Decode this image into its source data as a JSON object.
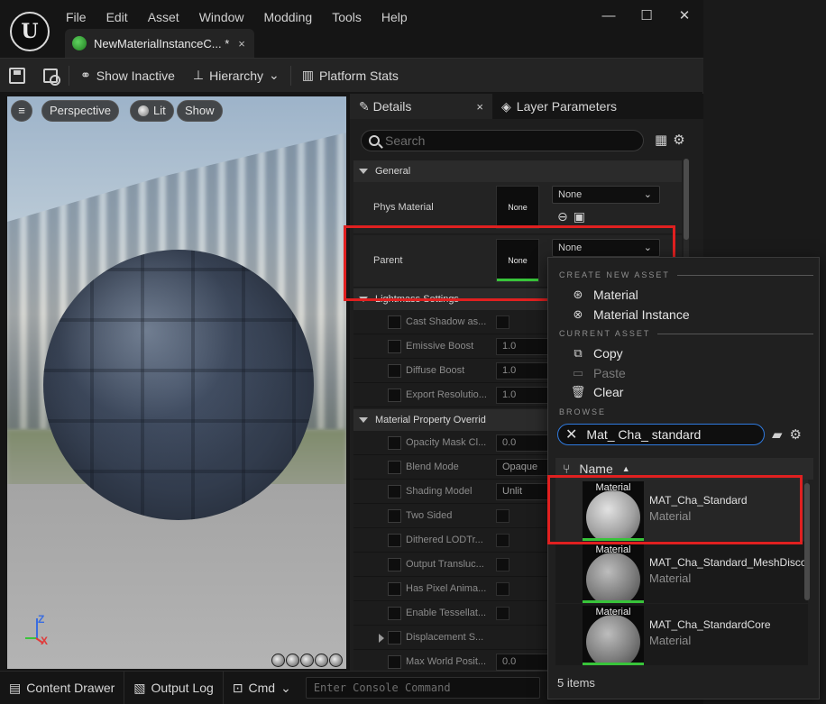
{
  "menu": {
    "items": [
      "File",
      "Edit",
      "Asset",
      "Window",
      "Modding",
      "Tools",
      "Help"
    ]
  },
  "window_controls": {
    "minimize": "—",
    "maximize": "☐",
    "close": "✕"
  },
  "doc_tab": {
    "label": "NewMaterialInstanceC... *",
    "close": "×"
  },
  "toolbar": {
    "show_inactive": "Show Inactive",
    "hierarchy": "Hierarchy",
    "platform_stats": "Platform Stats"
  },
  "viewport": {
    "perspective": "Perspective",
    "lit": "Lit",
    "show": "Show",
    "axis_z": "Z",
    "axis_x": "X"
  },
  "details": {
    "tab_details": "Details",
    "tab_layer_params": "Layer Parameters",
    "search_placeholder": "Search",
    "category_general": "General",
    "phys_material_label": "Phys Material",
    "phys_material_thumb": "None",
    "phys_material_value": "None",
    "parent_label": "Parent",
    "parent_thumb": "None",
    "parent_value": "None",
    "category_lightmass": "Lightmass Settings",
    "lightmass_rows": [
      {
        "label": "Cast Shadow as...",
        "kind": "check"
      },
      {
        "label": "Emissive Boost",
        "kind": "num",
        "value": "1.0"
      },
      {
        "label": "Diffuse Boost",
        "kind": "num",
        "value": "1.0"
      },
      {
        "label": "Export Resolutio...",
        "kind": "num",
        "value": "1.0"
      }
    ],
    "category_material_overrides": "Material Property Overrid",
    "override_rows": [
      {
        "label": "Opacity Mask Cl...",
        "kind": "num",
        "value": "0.0"
      },
      {
        "label": "Blend Mode",
        "kind": "opt",
        "value": "Opaque"
      },
      {
        "label": "Shading Model",
        "kind": "opt",
        "value": "Unlit"
      },
      {
        "label": "Two Sided",
        "kind": "check"
      },
      {
        "label": "Dithered LODTr...",
        "kind": "check"
      },
      {
        "label": "Output Transluc...",
        "kind": "check"
      },
      {
        "label": "Has Pixel Anima...",
        "kind": "check"
      },
      {
        "label": "Enable Tessellat...",
        "kind": "check"
      },
      {
        "label": "Displacement S...",
        "kind": "none"
      },
      {
        "label": "Max World Posit...",
        "kind": "num",
        "value": "0.0"
      }
    ]
  },
  "picker": {
    "section_create": "CREATE NEW ASSET",
    "create_material": "Material",
    "create_material_instance": "Material Instance",
    "section_current": "CURRENT ASSET",
    "copy": "Copy",
    "paste": "Paste",
    "clear": "Clear",
    "section_browse": "BROWSE",
    "search_value": "Mat_ Cha_ standard",
    "column_name": "Name",
    "sort_indicator": "▲",
    "assets": [
      {
        "thumb_label": "Material",
        "name": "MAT_Cha_Standard",
        "type": "Material"
      },
      {
        "thumb_label": "Material",
        "name": "MAT_Cha_Standard_MeshDisco",
        "type": "Material"
      },
      {
        "thumb_label": "Material",
        "name": "MAT_Cha_StandardCore",
        "type": "Material"
      }
    ],
    "item_count": "5 items"
  },
  "bottombar": {
    "content_drawer": "Content Drawer",
    "output_log": "Output Log",
    "cmd": "Cmd",
    "console_placeholder": "Enter Console Command"
  },
  "colors": {
    "highlight": "#e02020",
    "accent_green": "#38c43a",
    "search_focus": "#2f7adf"
  }
}
